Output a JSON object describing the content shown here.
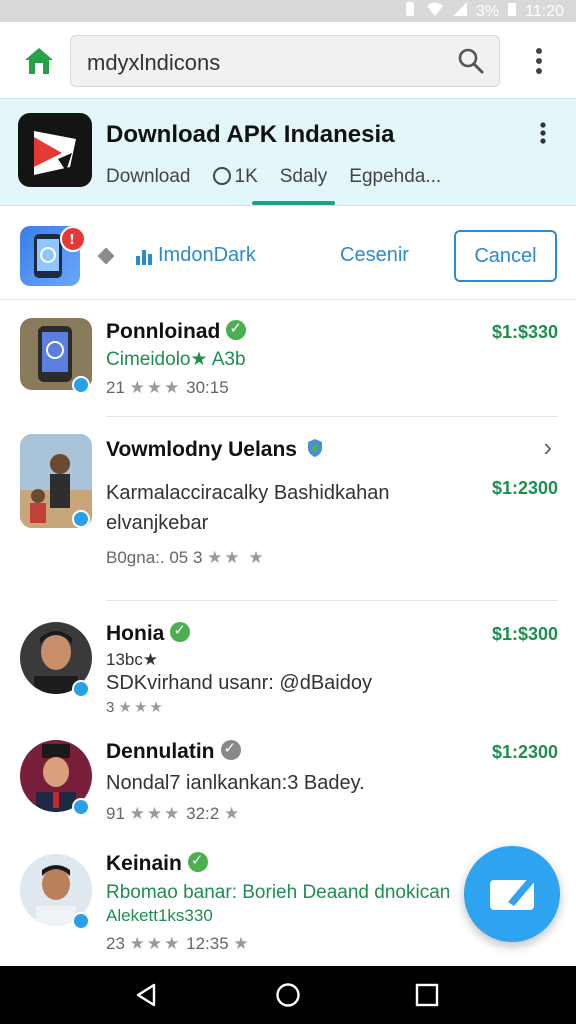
{
  "status_bar": {
    "battery": "3%",
    "time": "11:20"
  },
  "search": {
    "query": "mdyxlndicons"
  },
  "app": {
    "title": "Download APK Indanesia",
    "tabs": [
      {
        "label": "Download"
      },
      {
        "label": "1K"
      },
      {
        "label": "Sdaly"
      },
      {
        "label": "Egpehda..."
      }
    ]
  },
  "action_row": {
    "primary_link": "ImdonDark",
    "secondary_link": "Cesenir",
    "cancel_label": "Cancel"
  },
  "items": [
    {
      "name": "Ponnloinad",
      "line1": "Cimeidolo★ A3b",
      "meta_num": "21",
      "meta_stars": "★★★",
      "meta_time": "30:15",
      "price": "$1:$330"
    },
    {
      "name": "Vowmlodny Uelans",
      "line1": "Karmalacciracalky Bashidkahan",
      "line2": "elvanjkebar",
      "meta_num": "B0gna:. 05 3",
      "meta_stars": "★★ ★",
      "price": "$1:2300",
      "chevron": "›"
    },
    {
      "name": "Honia",
      "line1": "13bc★",
      "line2": "SDKvirhand usanr: @dBaidoy",
      "meta_num": "3",
      "meta_stars": "★★★",
      "price": "$1:$300"
    },
    {
      "name": "Dennulatin",
      "line1": "Nondal7 ianlkankan:3 Badey.",
      "meta_num": "91",
      "meta_stars": "★★★",
      "meta_time": "32:2",
      "meta_trail": "★",
      "price": "$1:2300"
    },
    {
      "name": "Keinain",
      "line1": "Rbomao banar: Borieh Deaand dnokican",
      "line2": "Alekett1ks330",
      "meta_num": "23",
      "meta_stars": "★★★",
      "meta_time": "12:35",
      "meta_trail": "★"
    }
  ],
  "colors": {
    "accent": "#2b8ad1",
    "green": "#1e8e4e",
    "header_bg": "#e3f6fa",
    "fab": "#2ea3ef"
  }
}
